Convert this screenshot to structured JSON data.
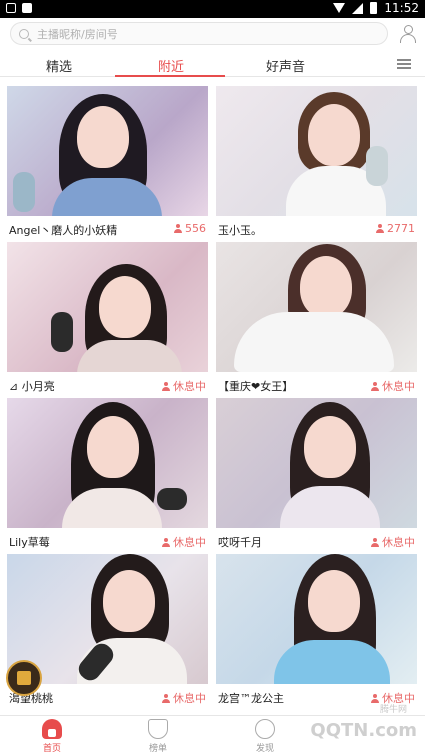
{
  "status_bar": {
    "time": "11:52"
  },
  "search": {
    "placeholder": "主播昵称/房间号"
  },
  "tabs": [
    {
      "label": "精选"
    },
    {
      "label": "附近",
      "active": true
    },
    {
      "label": "好声音"
    }
  ],
  "cards": [
    {
      "name": "Angel丶磨人的小妖精",
      "meta": "556",
      "meta_type": "viewers"
    },
    {
      "name": "玉小玉。",
      "meta": "2771",
      "meta_type": "viewers"
    },
    {
      "name": "⊿ 小月亮",
      "meta": "休息中",
      "meta_type": "resting"
    },
    {
      "name": "【重庆❤女王】",
      "meta": "休息中",
      "meta_type": "resting"
    },
    {
      "name": "Lily草莓",
      "meta": "休息中",
      "meta_type": "resting"
    },
    {
      "name": "哎呀千月",
      "meta": "休息中",
      "meta_type": "resting"
    },
    {
      "name": "渴望桃桃",
      "meta": "休息中",
      "meta_type": "resting"
    },
    {
      "name": "龙宫™龙公主",
      "meta": "休息中",
      "meta_type": "resting"
    }
  ],
  "bottom_nav": [
    {
      "label": "首页",
      "icon": "home-icon",
      "active": true
    },
    {
      "label": "榜单",
      "icon": "trophy-icon"
    },
    {
      "label": "发现",
      "icon": "discover-icon"
    }
  ],
  "watermark": {
    "brand": "QQTN.com",
    "sub": "腾牛网"
  },
  "colors": {
    "accent": "#e74c4c",
    "meta": "#e86a6a"
  }
}
